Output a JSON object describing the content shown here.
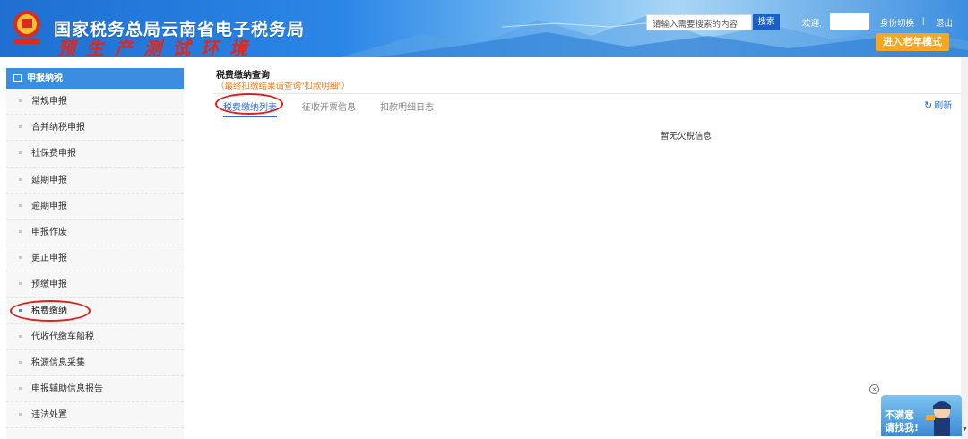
{
  "header": {
    "title": "国家税务总局云南省电子税务局",
    "environment": "预生产测试环境",
    "search_placeholder": "请输入需要搜索的内容",
    "search_label": "搜索",
    "welcome": "欢迎,",
    "switch_identity": "身份切换",
    "separator": "|",
    "logout": "退出",
    "elder_mode": "进入老年模式",
    "colors": {
      "primary": "#2a86e6",
      "accent": "#f5a623",
      "env_text": "#e1261c"
    }
  },
  "sidebar": {
    "section_title": "申报纳税",
    "items": [
      {
        "label": "常规申报"
      },
      {
        "label": "合并纳税申报"
      },
      {
        "label": "社保费申报"
      },
      {
        "label": "延期申报"
      },
      {
        "label": "逾期申报"
      },
      {
        "label": "申报作废"
      },
      {
        "label": "更正申报"
      },
      {
        "label": "预缴申报"
      },
      {
        "label": "税费缴纳"
      },
      {
        "label": "代收代缴车船税"
      },
      {
        "label": "税源信息采集"
      },
      {
        "label": "申报辅助信息报告"
      },
      {
        "label": "违法处置"
      }
    ],
    "active_index": 8
  },
  "main": {
    "title": "税费缴纳查询",
    "note": "（最终扣缴结果请查询\"扣款明细\"）",
    "tabs": [
      {
        "label": "税费缴纳列表"
      },
      {
        "label": "征收开票信息"
      },
      {
        "label": "扣款明细日志"
      }
    ],
    "refresh_label": "刷新",
    "empty_message": "暂无欠税信息"
  },
  "helper": {
    "line1": "不满意",
    "line2": "请找我!",
    "close_symbol": "×"
  },
  "icons": {
    "emblem": "national-tax-emblem-icon",
    "refresh": "refresh-icon",
    "sidebar_head": "document-icon",
    "close": "close-icon"
  }
}
